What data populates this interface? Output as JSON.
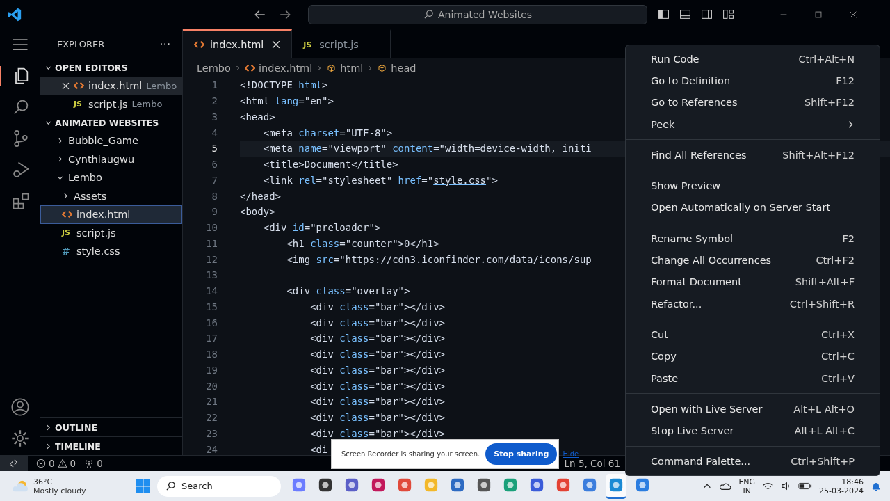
{
  "title_bar": {
    "search": "Animated Websites"
  },
  "activity_bar": [
    {
      "kind": "files",
      "selected": true
    },
    {
      "kind": "search",
      "selected": false
    },
    {
      "kind": "source",
      "selected": false
    },
    {
      "kind": "debug",
      "selected": false
    },
    {
      "kind": "extensions",
      "selected": false
    }
  ],
  "sidebar": {
    "title": "EXPLORER",
    "more": "···",
    "open_editors": {
      "title": "OPEN EDITORS",
      "expanded": true,
      "items": [
        {
          "name": "index.html",
          "folder": "Lembo",
          "kind": "html",
          "selected": true
        },
        {
          "name": "script.js",
          "folder": "Lembo",
          "kind": "js",
          "badge": "JS",
          "selected": false
        }
      ]
    },
    "workspace": {
      "title": "ANIMATED WEBSITES",
      "expanded": true,
      "items": [
        {
          "name": "Bubble_Game",
          "kind": "folder",
          "expanded": false,
          "selected": false
        },
        {
          "name": "Cynthiaugwu",
          "kind": "folder",
          "expanded": false,
          "selected": false
        },
        {
          "name": "Lembo",
          "kind": "folder",
          "expanded": true,
          "selected": false,
          "children": [
            {
              "name": "Assets",
              "kind": "folder",
              "expanded": false,
              "selected": false
            },
            {
              "name": "index.html",
              "kind": "html",
              "selected": true
            },
            {
              "name": "script.js",
              "kind": "js",
              "badge": "JS",
              "selected": false
            },
            {
              "name": "style.css",
              "kind": "css",
              "badge": "#",
              "selected": false
            }
          ]
        }
      ]
    },
    "panels": [
      {
        "title": "OUTLINE",
        "expanded": false
      },
      {
        "title": "TIMELINE",
        "expanded": false
      }
    ]
  },
  "tabs": [
    {
      "label": "index.html",
      "kind": "html",
      "selected": true
    },
    {
      "label": "script.js",
      "kind": "js",
      "badge": "JS",
      "selected": false
    }
  ],
  "breadcrumb": [
    {
      "label": "Lembo",
      "kind": "folder"
    },
    {
      "label": "index.html",
      "kind": "html"
    },
    {
      "label": "html",
      "kind": "element"
    },
    {
      "label": "head",
      "kind": "element"
    }
  ],
  "code": [
    {
      "n": "1",
      "current": false,
      "tokens": [
        {
          "kind": "plain",
          "text": "<!DOCTYPE "
        },
        {
          "kind": "attr",
          "text": "html"
        },
        {
          "kind": "plain",
          "text": ">"
        }
      ]
    },
    {
      "n": "2",
      "current": false,
      "tokens": [
        {
          "kind": "plain",
          "text": "<html "
        },
        {
          "kind": "attr",
          "text": "lang"
        },
        {
          "kind": "plain",
          "text": "=\"en\">"
        }
      ]
    },
    {
      "n": "3",
      "current": false,
      "tokens": [
        {
          "kind": "plain",
          "text": "<head>"
        }
      ]
    },
    {
      "n": "4",
      "current": false,
      "tokens": [
        {
          "kind": "plain",
          "text": "    <meta "
        },
        {
          "kind": "attr",
          "text": "charset"
        },
        {
          "kind": "plain",
          "text": "=\"UTF-8\">"
        }
      ]
    },
    {
      "n": "5",
      "current": true,
      "tokens": [
        {
          "kind": "plain",
          "text": "    <meta "
        },
        {
          "kind": "attr",
          "text": "name"
        },
        {
          "kind": "plain",
          "text": "=\"viewport\" "
        },
        {
          "kind": "attr",
          "text": "content"
        },
        {
          "kind": "plain",
          "text": "=\"width=device-width, initi"
        }
      ]
    },
    {
      "n": "6",
      "current": false,
      "tokens": [
        {
          "kind": "plain",
          "text": "    <title>Document</title>"
        }
      ]
    },
    {
      "n": "7",
      "current": false,
      "tokens": [
        {
          "kind": "plain",
          "text": "    <link "
        },
        {
          "kind": "attr",
          "text": "rel"
        },
        {
          "kind": "plain",
          "text": "=\"stylesheet\" "
        },
        {
          "kind": "attr",
          "text": "href"
        },
        {
          "kind": "plain",
          "text": "=\""
        },
        {
          "kind": "link",
          "text": "style.css"
        },
        {
          "kind": "plain",
          "text": "\">"
        }
      ]
    },
    {
      "n": "8",
      "current": false,
      "tokens": [
        {
          "kind": "plain",
          "text": "</head>"
        }
      ]
    },
    {
      "n": "9",
      "current": false,
      "tokens": [
        {
          "kind": "plain",
          "text": "<body>"
        }
      ]
    },
    {
      "n": "10",
      "current": false,
      "tokens": [
        {
          "kind": "plain",
          "text": "    <div "
        },
        {
          "kind": "attr",
          "text": "id"
        },
        {
          "kind": "plain",
          "text": "=\"preloader\">"
        }
      ]
    },
    {
      "n": "11",
      "current": false,
      "tokens": [
        {
          "kind": "plain",
          "text": "        <h1 "
        },
        {
          "kind": "attr",
          "text": "class"
        },
        {
          "kind": "plain",
          "text": "=\"counter\">0</h1>"
        }
      ]
    },
    {
      "n": "12",
      "current": false,
      "tokens": [
        {
          "kind": "plain",
          "text": "        <img "
        },
        {
          "kind": "attr",
          "text": "src"
        },
        {
          "kind": "plain",
          "text": "=\""
        },
        {
          "kind": "link",
          "text": "https://cdn3.iconfinder.com/data/icons/sup"
        }
      ]
    },
    {
      "n": "13",
      "current": false
    },
    {
      "n": "14",
      "current": false,
      "tokens": [
        {
          "kind": "plain",
          "text": "        <div "
        },
        {
          "kind": "attr",
          "text": "class"
        },
        {
          "kind": "plain",
          "text": "=\"overlay\">"
        }
      ]
    },
    {
      "n": "15",
      "current": false,
      "tokens": [
        {
          "kind": "plain",
          "text": "            <div "
        },
        {
          "kind": "attr",
          "text": "class"
        },
        {
          "kind": "plain",
          "text": "=\"bar\"></div>"
        }
      ]
    },
    {
      "n": "16",
      "current": false,
      "tokens": [
        {
          "kind": "plain",
          "text": "            <div "
        },
        {
          "kind": "attr",
          "text": "class"
        },
        {
          "kind": "plain",
          "text": "=\"bar\"></div>"
        }
      ]
    },
    {
      "n": "17",
      "current": false,
      "tokens": [
        {
          "kind": "plain",
          "text": "            <div "
        },
        {
          "kind": "attr",
          "text": "class"
        },
        {
          "kind": "plain",
          "text": "=\"bar\"></div>"
        }
      ]
    },
    {
      "n": "18",
      "current": false,
      "tokens": [
        {
          "kind": "plain",
          "text": "            <div "
        },
        {
          "kind": "attr",
          "text": "class"
        },
        {
          "kind": "plain",
          "text": "=\"bar\"></div>"
        }
      ]
    },
    {
      "n": "19",
      "current": false,
      "tokens": [
        {
          "kind": "plain",
          "text": "            <div "
        },
        {
          "kind": "attr",
          "text": "class"
        },
        {
          "kind": "plain",
          "text": "=\"bar\"></div>"
        }
      ]
    },
    {
      "n": "20",
      "current": false,
      "tokens": [
        {
          "kind": "plain",
          "text": "            <div "
        },
        {
          "kind": "attr",
          "text": "class"
        },
        {
          "kind": "plain",
          "text": "=\"bar\"></div>"
        }
      ]
    },
    {
      "n": "21",
      "current": false,
      "tokens": [
        {
          "kind": "plain",
          "text": "            <div "
        },
        {
          "kind": "attr",
          "text": "class"
        },
        {
          "kind": "plain",
          "text": "=\"bar\"></div>"
        }
      ]
    },
    {
      "n": "22",
      "current": false,
      "tokens": [
        {
          "kind": "plain",
          "text": "            <div "
        },
        {
          "kind": "attr",
          "text": "class"
        },
        {
          "kind": "plain",
          "text": "=\"bar\"></div>"
        }
      ]
    },
    {
      "n": "23",
      "current": false,
      "tokens": [
        {
          "kind": "plain",
          "text": "            <div "
        },
        {
          "kind": "attr",
          "text": "class"
        },
        {
          "kind": "plain",
          "text": "=\"bar\"></div>"
        }
      ]
    },
    {
      "n": "24",
      "current": false,
      "tokens": [
        {
          "kind": "plain",
          "text": "            <di"
        }
      ]
    }
  ],
  "context_menu": [
    [
      {
        "label": "Run Code",
        "shortcut": "Ctrl+Alt+N",
        "kind": "command"
      },
      {
        "label": "Go to Definition",
        "shortcut": "F12",
        "kind": "command"
      },
      {
        "label": "Go to References",
        "shortcut": "Shift+F12",
        "kind": "command"
      },
      {
        "label": "Peek",
        "kind": "submenu"
      }
    ],
    [
      {
        "label": "Find All References",
        "shortcut": "Shift+Alt+F12",
        "kind": "command"
      }
    ],
    [
      {
        "label": "Show Preview",
        "kind": "command"
      },
      {
        "label": "Open Automatically on Server Start",
        "kind": "command"
      }
    ],
    [
      {
        "label": "Rename Symbol",
        "shortcut": "F2",
        "kind": "command"
      },
      {
        "label": "Change All Occurrences",
        "shortcut": "Ctrl+F2",
        "kind": "command"
      },
      {
        "label": "Format Document",
        "shortcut": "Shift+Alt+F",
        "kind": "command"
      },
      {
        "label": "Refactor...",
        "shortcut": "Ctrl+Shift+R",
        "kind": "command"
      }
    ],
    [
      {
        "label": "Cut",
        "shortcut": "Ctrl+X",
        "kind": "command"
      },
      {
        "label": "Copy",
        "shortcut": "Ctrl+C",
        "kind": "command"
      },
      {
        "label": "Paste",
        "shortcut": "Ctrl+V",
        "kind": "command"
      }
    ],
    [
      {
        "label": "Open with Live Server",
        "shortcut": "Alt+L Alt+O",
        "kind": "command"
      },
      {
        "label": "Stop Live Server",
        "shortcut": "Alt+L Alt+C",
        "kind": "command"
      }
    ],
    [
      {
        "label": "Command Palette...",
        "shortcut": "Ctrl+Shift+P",
        "kind": "command"
      }
    ]
  ],
  "status_bar": {
    "errors": "0",
    "warnings": "0",
    "ports": "0",
    "position": "Ln 5, Col 61"
  },
  "share_banner": {
    "message": "Screen Recorder is sharing your screen.",
    "stop": "Stop sharing",
    "hide": "Hide"
  },
  "taskbar": {
    "temperature": "36°C",
    "weather": "Mostly cloudy",
    "search": "Search",
    "apps": [
      {
        "kind": "copilot",
        "active": false
      },
      {
        "kind": "window",
        "active": false
      },
      {
        "kind": "teams",
        "active": false
      },
      {
        "kind": "ide",
        "active": false
      },
      {
        "kind": "figma",
        "active": false
      },
      {
        "kind": "folder",
        "active": false
      },
      {
        "kind": "store",
        "active": false
      },
      {
        "kind": "gem",
        "active": false
      },
      {
        "kind": "edge",
        "active": false
      },
      {
        "kind": "m",
        "active": false
      },
      {
        "kind": "chrome",
        "active": false
      },
      {
        "kind": "a",
        "active": false
      },
      {
        "kind": "vscode",
        "active": true
      },
      {
        "kind": "recorder",
        "active": false
      }
    ],
    "language": "ENG",
    "region": "IN",
    "time": "18:46",
    "date": "25-03-2024"
  }
}
